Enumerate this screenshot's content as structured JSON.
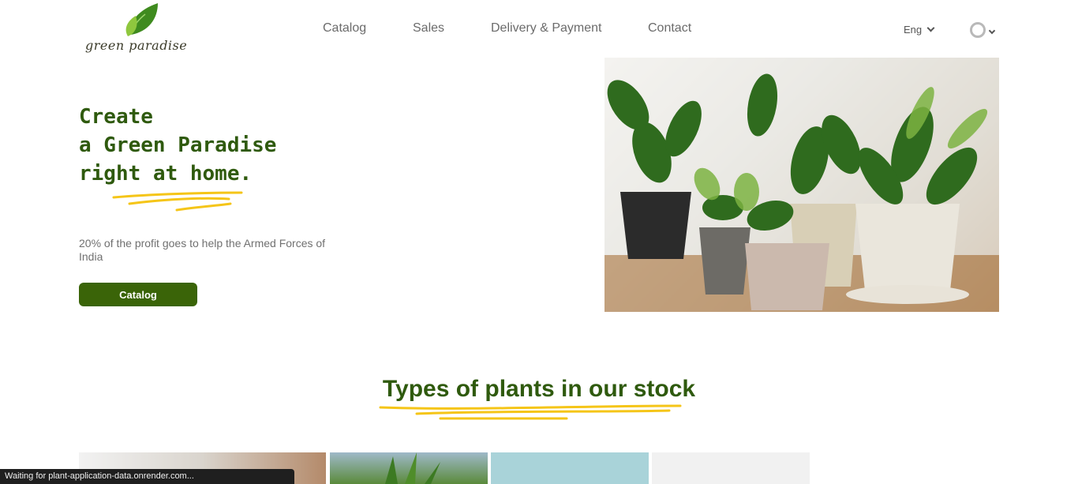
{
  "header": {
    "logo_text": "green paradise",
    "nav": [
      {
        "label": "Catalog"
      },
      {
        "label": "Sales"
      },
      {
        "label": "Delivery & Payment"
      },
      {
        "label": "Contact"
      }
    ],
    "language": "Eng"
  },
  "hero": {
    "title": "Create\na Green Paradise\nright at home.",
    "subtitle": "20% of the profit goes to help the Armed Forces of India",
    "button_label": "Catalog",
    "accent_color": "#3a6408",
    "highlight_color": "#f5c518"
  },
  "section": {
    "title": "Types of plants in our stock"
  },
  "status_bar": {
    "text": "Waiting for plant-application-data.onrender.com..."
  }
}
